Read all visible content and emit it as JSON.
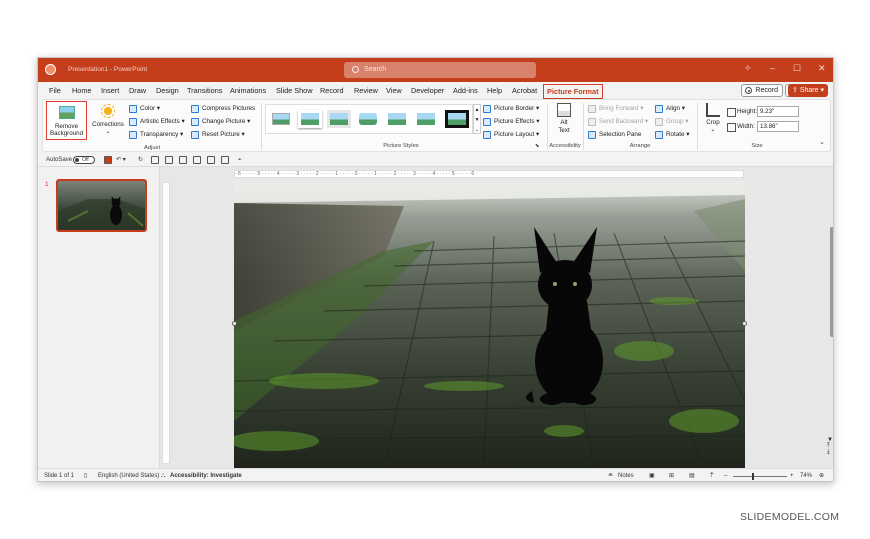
{
  "titlebar": {
    "doc_title": "Presentation1 - PowerPoint",
    "search_placeholder": "Search",
    "controls": [
      "lightbulb-icon",
      "minimize-icon",
      "restore-icon",
      "close-icon"
    ]
  },
  "tabs": {
    "items": [
      {
        "label": "File"
      },
      {
        "label": "Home"
      },
      {
        "label": "Insert"
      },
      {
        "label": "Draw"
      },
      {
        "label": "Design"
      },
      {
        "label": "Transitions"
      },
      {
        "label": "Animations"
      },
      {
        "label": "Slide Show"
      },
      {
        "label": "Record"
      },
      {
        "label": "Review"
      },
      {
        "label": "View"
      },
      {
        "label": "Developer"
      },
      {
        "label": "Add-ins"
      },
      {
        "label": "Help"
      },
      {
        "label": "Acrobat"
      },
      {
        "label": "Picture Format"
      }
    ],
    "active": "Picture Format",
    "record_label": "Record",
    "share_label": "Share"
  },
  "ribbon": {
    "adjust": {
      "label": "Adjust",
      "remove_bg_line1": "Remove",
      "remove_bg_line2": "Background",
      "corrections": "Corrections",
      "color": "Color",
      "artistic_effects": "Artistic Effects",
      "transparency": "Transparency",
      "compress": "Compress Pictures",
      "change": "Change Picture",
      "reset": "Reset Picture"
    },
    "picture_styles": {
      "label": "Picture Styles",
      "border": "Picture Border",
      "effects": "Picture Effects",
      "layout": "Picture Layout"
    },
    "accessibility": {
      "label": "Accessibility",
      "alt_text_line1": "Alt",
      "alt_text_line2": "Text"
    },
    "arrange": {
      "label": "Arrange",
      "bring_forward": "Bring Forward",
      "send_backward": "Send Backward",
      "selection_pane": "Selection Pane",
      "align": "Align",
      "group": "Group",
      "rotate": "Rotate"
    },
    "size": {
      "label": "Size",
      "crop": "Crop",
      "height_label": "Height:",
      "height_value": "9.23\"",
      "width_label": "Width:",
      "width_value": "13.86\""
    }
  },
  "qat": {
    "autosave_label": "AutoSave",
    "autosave_state": "Off"
  },
  "slides_panel": {
    "slide_number": "1"
  },
  "ruler": {
    "top_ticks": "· 6 · · · · · 5 · · · · · 4 · · · · · 3 · · · · · 2 · · · · · 1 · · · · · 0 · · · · · 1 · · · · · 2 · · · · · 3 · · · · · 4 · · · · · 5 · · · · · 6 ·"
  },
  "status": {
    "slide_of": "Slide 1 of 1",
    "language": "English (United States)",
    "accessibility": "Accessibility: Investigate",
    "notes": "Notes",
    "zoom": "74%"
  },
  "credit": "SLIDEMODEL.COM",
  "colors": {
    "accent": "#c43e1c",
    "highlight_box": "#e03c31"
  }
}
